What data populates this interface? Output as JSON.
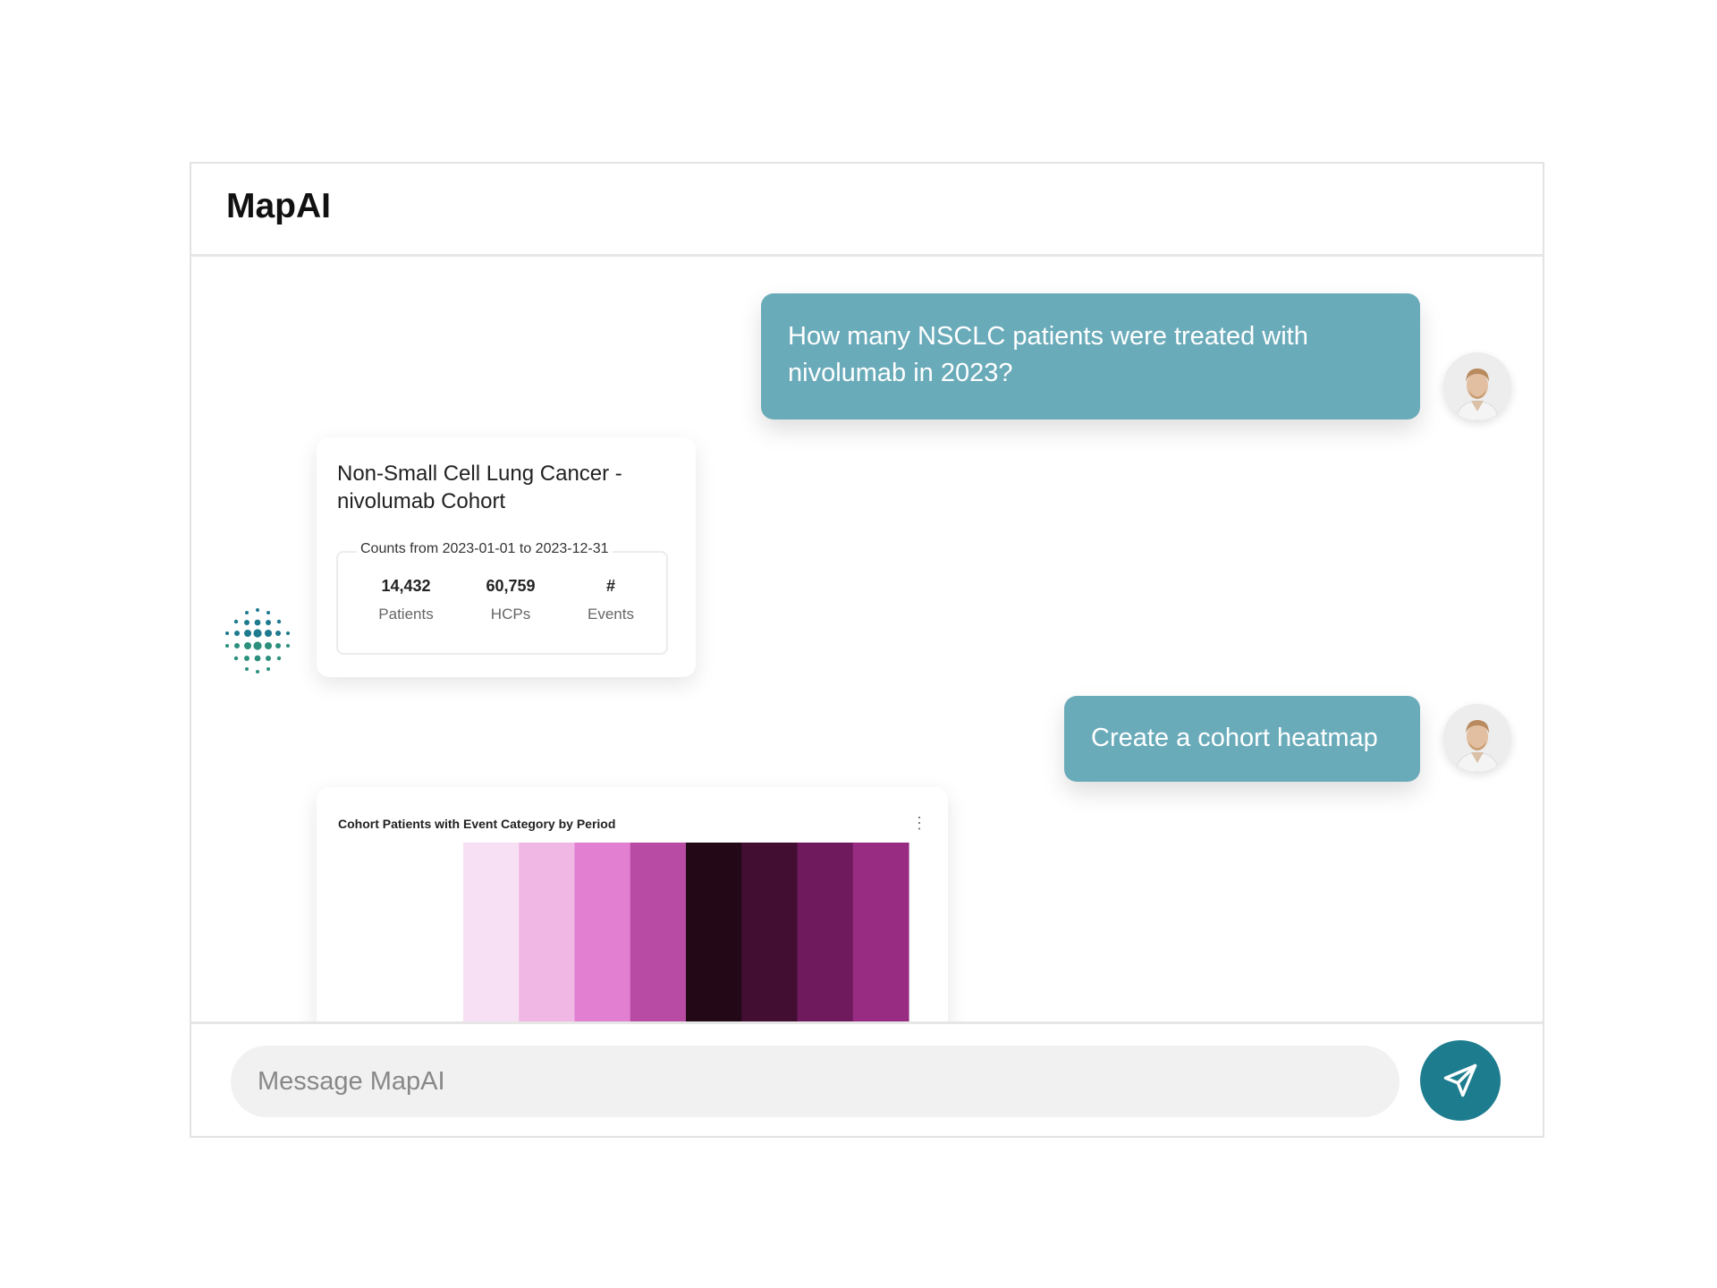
{
  "app": {
    "title": "MapAI"
  },
  "messages": {
    "user_1": "How many NSCLC patients were treated with nivolumab in 2023?",
    "user_2": "Create a cohort heatmap"
  },
  "cohort_card": {
    "title": "Non-Small Cell Lung Cancer - nivolumab Cohort",
    "counts_label": "Counts from 2023-01-01 to 2023-12-31",
    "stats": [
      {
        "value": "14,432",
        "label": "Patients"
      },
      {
        "value": "60,759",
        "label": "HCPs"
      },
      {
        "value": "#",
        "label": "Events"
      }
    ]
  },
  "heatmap_card": {
    "title": "Cohort Patients with Event Category by Period",
    "menu_icon": "vertical-ellipsis-icon"
  },
  "chart_data": {
    "type": "heatmap",
    "title": "Cohort Patients with Event Category by Period",
    "columns": 8,
    "cell_colors": [
      "#f7e0f3",
      "#f0b7e5",
      "#e27fd1",
      "#b84ba3",
      "#230817",
      "#420f32",
      "#6e1a5c",
      "#982c82"
    ]
  },
  "input": {
    "placeholder": "Message MapAI",
    "value": ""
  },
  "icons": {
    "send": "send-paper-plane-icon",
    "bot": "mapai-dot-logo-icon",
    "avatar": "user-avatar"
  },
  "colors": {
    "user_bubble": "#6aabba",
    "send_button": "#1d7d8f"
  }
}
